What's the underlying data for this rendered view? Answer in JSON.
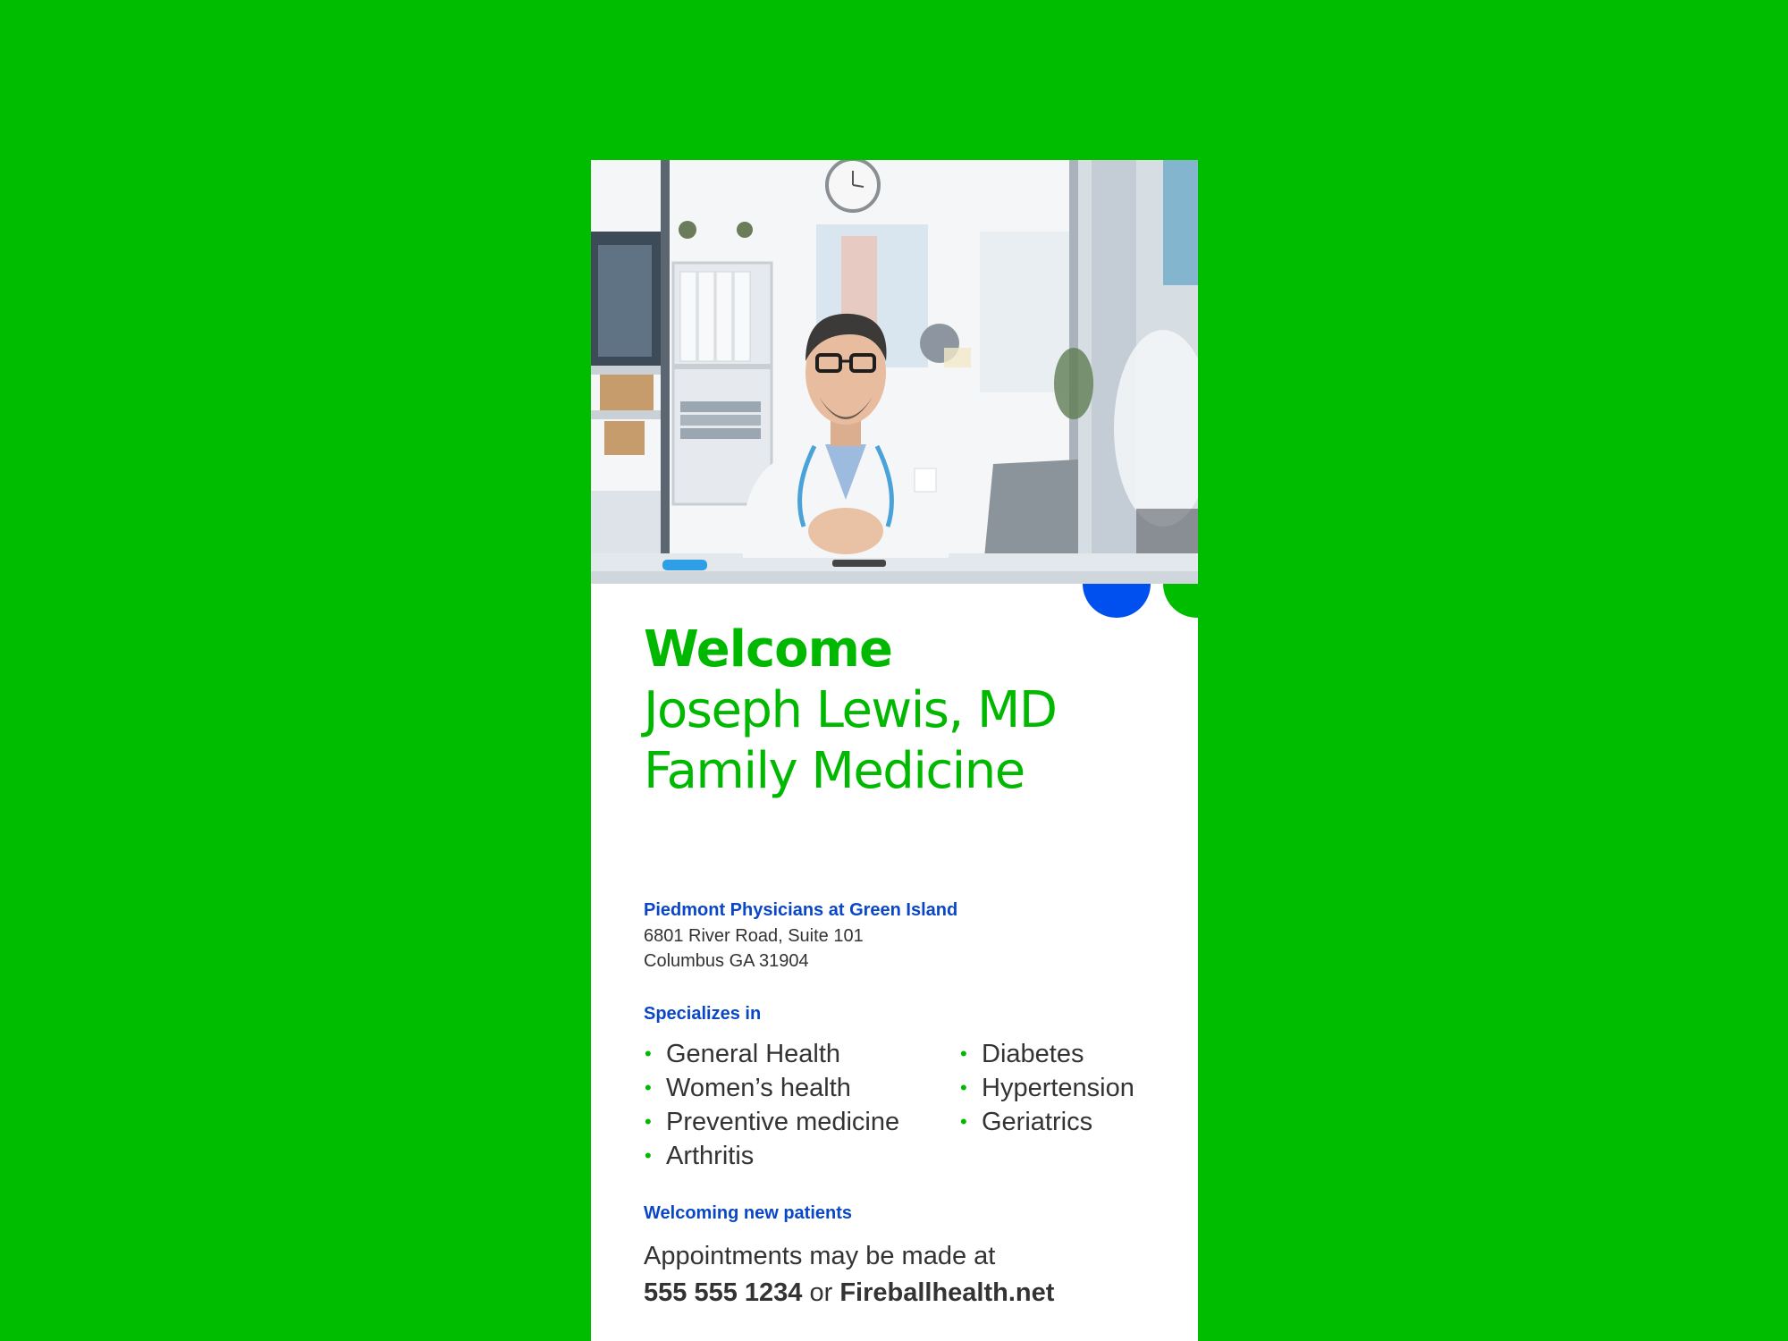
{
  "colors": {
    "background": "#00bd00",
    "brand_green": "#00b800",
    "brand_blue": "#0050ef",
    "heading_blue": "#0a47c8",
    "text": "#333333"
  },
  "hero_image": {
    "icon": "doctor-photo"
  },
  "title": {
    "welcome": "Welcome",
    "name": "Joseph Lewis, MD",
    "specialty": "Family Medicine"
  },
  "practice": {
    "name": "Piedmont Physicians at Green Island",
    "address_line1": "6801 River Road, Suite 101",
    "address_line2": "Columbus GA 31904"
  },
  "specializes": {
    "heading": "Specializes in",
    "col1": [
      "General Health",
      "Women’s health",
      "Preventive medicine",
      "Arthritis"
    ],
    "col2": [
      "Diabetes",
      "Hypertension",
      "Geriatrics"
    ]
  },
  "patients": {
    "heading": "Welcoming new patients",
    "line1": "Appointments may be made at",
    "phone": "555 555 1234",
    "or": " or ",
    "website": "Fireballhealth.net"
  }
}
